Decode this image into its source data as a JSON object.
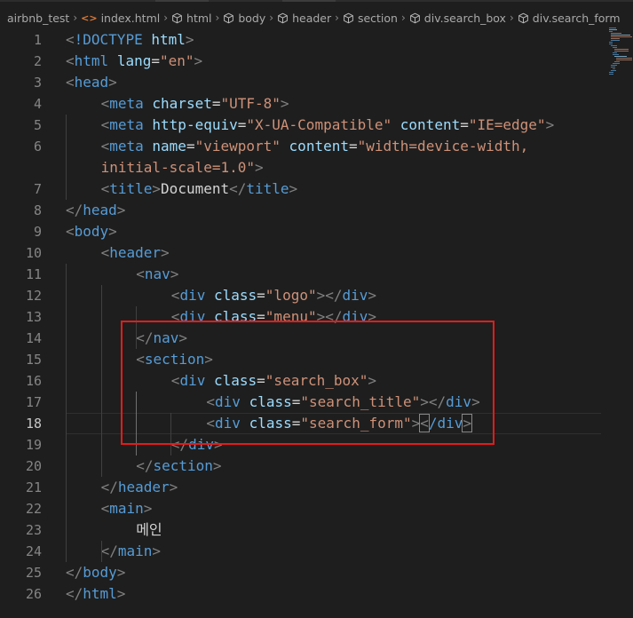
{
  "breadcrumb": [
    {
      "icon": "none",
      "label": "airbnb_test"
    },
    {
      "icon": "html-icon",
      "label": "index.html"
    },
    {
      "icon": "cube-icon",
      "label": "html"
    },
    {
      "icon": "cube-icon",
      "label": "body"
    },
    {
      "icon": "cube-icon",
      "label": "header"
    },
    {
      "icon": "cube-icon",
      "label": "section"
    },
    {
      "icon": "cube-icon",
      "label": "div.search_box"
    },
    {
      "icon": "cube-icon",
      "label": "div.search_form"
    }
  ],
  "colors": {
    "background": "#1e1e1e",
    "tag": "#569cd6",
    "punct": "#808080",
    "attr": "#9cdcfe",
    "string": "#ce9178",
    "text": "#d4d4d4",
    "line_number": "#858585",
    "annotation_box": "#e41b1b"
  },
  "editor": {
    "active_line": 18,
    "lines": [
      {
        "n": "1",
        "indent": 0,
        "tokens": [
          [
            "p",
            "<"
          ],
          [
            "t",
            "!DOCTYPE"
          ],
          [
            "x",
            " "
          ],
          [
            "a",
            "html"
          ],
          [
            "p",
            ">"
          ]
        ]
      },
      {
        "n": "2",
        "indent": 0,
        "tokens": [
          [
            "p",
            "<"
          ],
          [
            "t",
            "html"
          ],
          [
            "x",
            " "
          ],
          [
            "a",
            "lang"
          ],
          [
            "x",
            "="
          ],
          [
            "s",
            "\"en\""
          ],
          [
            "p",
            ">"
          ]
        ]
      },
      {
        "n": "3",
        "indent": 0,
        "tokens": [
          [
            "p",
            "<"
          ],
          [
            "t",
            "head"
          ],
          [
            "p",
            ">"
          ]
        ]
      },
      {
        "n": "4",
        "indent": 1,
        "tokens": [
          [
            "p",
            "<"
          ],
          [
            "t",
            "meta"
          ],
          [
            "x",
            " "
          ],
          [
            "a",
            "charset"
          ],
          [
            "x",
            "="
          ],
          [
            "s",
            "\"UTF-8\""
          ],
          [
            "p",
            ">"
          ]
        ]
      },
      {
        "n": "5",
        "indent": 1,
        "tokens": [
          [
            "p",
            "<"
          ],
          [
            "t",
            "meta"
          ],
          [
            "x",
            " "
          ],
          [
            "a",
            "http-equiv"
          ],
          [
            "x",
            "="
          ],
          [
            "s",
            "\"X-UA-Compatible\""
          ],
          [
            "x",
            " "
          ],
          [
            "a",
            "content"
          ],
          [
            "x",
            "="
          ],
          [
            "s",
            "\"IE=edge\""
          ],
          [
            "p",
            ">"
          ]
        ]
      },
      {
        "n": "6",
        "indent": 1,
        "tokens": [
          [
            "p",
            "<"
          ],
          [
            "t",
            "meta"
          ],
          [
            "x",
            " "
          ],
          [
            "a",
            "name"
          ],
          [
            "x",
            "="
          ],
          [
            "s",
            "\"viewport\""
          ],
          [
            "x",
            " "
          ],
          [
            "a",
            "content"
          ],
          [
            "x",
            "="
          ],
          [
            "s",
            "\"width=device-width,"
          ]
        ]
      },
      {
        "n": "",
        "indent": 1,
        "tokens": [
          [
            "s",
            "initial-scale=1.0\""
          ],
          [
            "p",
            ">"
          ]
        ]
      },
      {
        "n": "7",
        "indent": 1,
        "tokens": [
          [
            "p",
            "<"
          ],
          [
            "t",
            "title"
          ],
          [
            "p",
            ">"
          ],
          [
            "x",
            "Document"
          ],
          [
            "p",
            "</"
          ],
          [
            "t",
            "title"
          ],
          [
            "p",
            ">"
          ]
        ]
      },
      {
        "n": "8",
        "indent": 0,
        "tokens": [
          [
            "p",
            "</"
          ],
          [
            "t",
            "head"
          ],
          [
            "p",
            ">"
          ]
        ]
      },
      {
        "n": "9",
        "indent": 0,
        "tokens": [
          [
            "p",
            "<"
          ],
          [
            "t",
            "body"
          ],
          [
            "p",
            ">"
          ]
        ]
      },
      {
        "n": "10",
        "indent": 1,
        "tokens": [
          [
            "p",
            "<"
          ],
          [
            "t",
            "header"
          ],
          [
            "p",
            ">"
          ]
        ]
      },
      {
        "n": "11",
        "indent": 2,
        "tokens": [
          [
            "p",
            "<"
          ],
          [
            "t",
            "nav"
          ],
          [
            "p",
            ">"
          ]
        ]
      },
      {
        "n": "12",
        "indent": 3,
        "tokens": [
          [
            "p",
            "<"
          ],
          [
            "t",
            "div"
          ],
          [
            "x",
            " "
          ],
          [
            "a",
            "class"
          ],
          [
            "x",
            "="
          ],
          [
            "s",
            "\"logo\""
          ],
          [
            "p",
            "></"
          ],
          [
            "t",
            "div"
          ],
          [
            "p",
            ">"
          ]
        ]
      },
      {
        "n": "13",
        "indent": 3,
        "tokens": [
          [
            "p",
            "<"
          ],
          [
            "t",
            "div"
          ],
          [
            "x",
            " "
          ],
          [
            "a",
            "class"
          ],
          [
            "x",
            "="
          ],
          [
            "s",
            "\"menu\""
          ],
          [
            "p",
            "></"
          ],
          [
            "t",
            "div"
          ],
          [
            "p",
            ">"
          ]
        ]
      },
      {
        "n": "14",
        "indent": 2,
        "tokens": [
          [
            "p",
            "</"
          ],
          [
            "t",
            "nav"
          ],
          [
            "p",
            ">"
          ]
        ]
      },
      {
        "n": "15",
        "indent": 2,
        "tokens": [
          [
            "p",
            "<"
          ],
          [
            "t",
            "section"
          ],
          [
            "p",
            ">"
          ]
        ]
      },
      {
        "n": "16",
        "indent": 3,
        "tokens": [
          [
            "p",
            "<"
          ],
          [
            "t",
            "div"
          ],
          [
            "x",
            " "
          ],
          [
            "a",
            "class"
          ],
          [
            "x",
            "="
          ],
          [
            "s",
            "\"search_box\""
          ],
          [
            "p",
            ">"
          ]
        ]
      },
      {
        "n": "17",
        "indent": 4,
        "tokens": [
          [
            "p",
            "<"
          ],
          [
            "t",
            "div"
          ],
          [
            "x",
            " "
          ],
          [
            "a",
            "class"
          ],
          [
            "x",
            "="
          ],
          [
            "s",
            "\"search_title\""
          ],
          [
            "p",
            "></"
          ],
          [
            "t",
            "div"
          ],
          [
            "p",
            ">"
          ]
        ]
      },
      {
        "n": "18",
        "indent": 4,
        "tokens": [
          [
            "p",
            "<"
          ],
          [
            "t",
            "div"
          ],
          [
            "x",
            " "
          ],
          [
            "a",
            "class"
          ],
          [
            "x",
            "="
          ],
          [
            "s",
            "\"search_form\""
          ],
          [
            "p",
            ">"
          ],
          [
            "bm",
            "<"
          ],
          [
            "t",
            "/div"
          ],
          [
            "bm",
            ">"
          ]
        ]
      },
      {
        "n": "19",
        "indent": 3,
        "tokens": [
          [
            "p",
            "</"
          ],
          [
            "t",
            "div"
          ],
          [
            "p",
            ">"
          ]
        ]
      },
      {
        "n": "20",
        "indent": 2,
        "tokens": [
          [
            "p",
            "</"
          ],
          [
            "t",
            "section"
          ],
          [
            "p",
            ">"
          ]
        ]
      },
      {
        "n": "21",
        "indent": 1,
        "tokens": [
          [
            "p",
            "</"
          ],
          [
            "t",
            "header"
          ],
          [
            "p",
            ">"
          ]
        ]
      },
      {
        "n": "22",
        "indent": 1,
        "tokens": [
          [
            "p",
            "<"
          ],
          [
            "t",
            "main"
          ],
          [
            "p",
            ">"
          ]
        ]
      },
      {
        "n": "23",
        "indent": 2,
        "tokens": [
          [
            "x",
            "메인"
          ]
        ]
      },
      {
        "n": "24",
        "indent": 1,
        "tokens": [
          [
            "p",
            "</"
          ],
          [
            "t",
            "main"
          ],
          [
            "p",
            ">"
          ]
        ]
      },
      {
        "n": "25",
        "indent": 0,
        "tokens": [
          [
            "p",
            "</"
          ],
          [
            "t",
            "body"
          ],
          [
            "p",
            ">"
          ]
        ]
      },
      {
        "n": "26",
        "indent": 0,
        "tokens": [
          [
            "p",
            "</"
          ],
          [
            "t",
            "html"
          ],
          [
            "p",
            ">"
          ]
        ]
      }
    ]
  }
}
